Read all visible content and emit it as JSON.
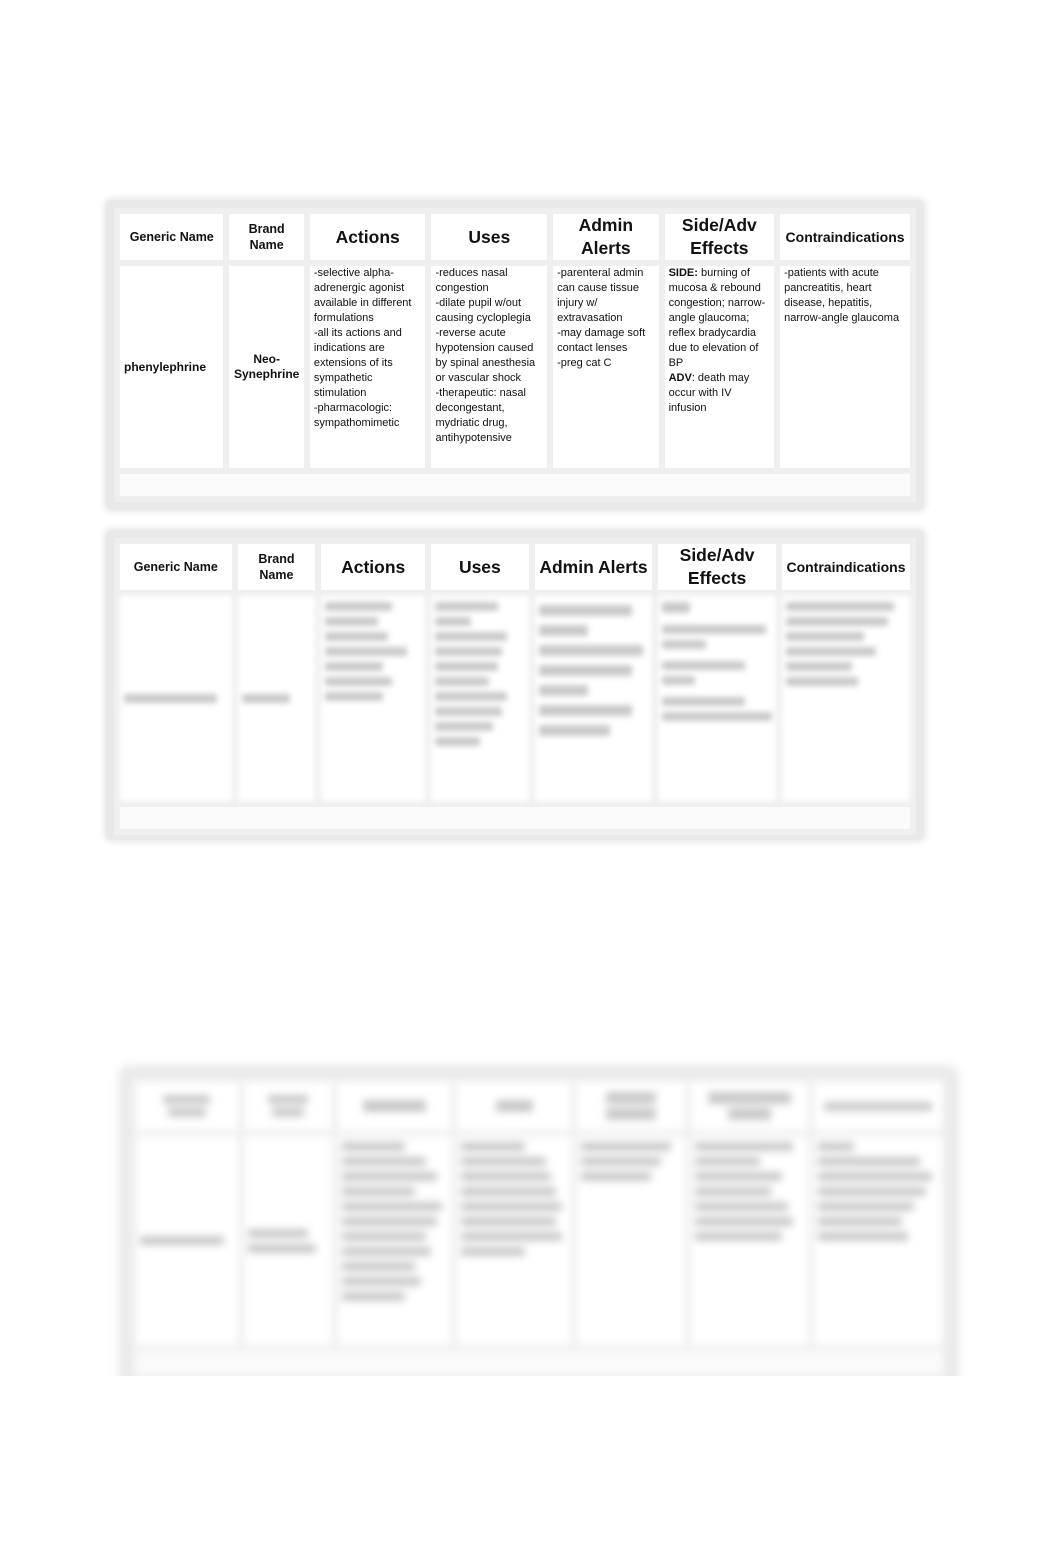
{
  "headers": {
    "generic": "Generic Name",
    "brand": "Brand Name",
    "actions": "Actions",
    "uses": "Uses",
    "admin": "Admin Alerts",
    "side": "Side/Adv Effects",
    "contra": "Contraindications"
  },
  "table1": {
    "generic_name": "phenylephrine",
    "brand_name": "Neo-Synephrine",
    "actions": [
      "-selective alpha-adrenergic agonist available in different formulations",
      "-all its actions and indications are extensions of its sympathetic stimulation",
      "-pharmacologic: sympathomimetic"
    ],
    "uses": [
      "-reduces nasal congestion",
      "-dilate pupil w/out causing cycloplegia",
      "-reverse acute hypotension caused by spinal anesthesia or vascular shock",
      "-therapeutic: nasal decongestant, mydriatic drug, antihypotensive"
    ],
    "admin_alerts": [
      "-parenteral admin can cause tissue injury w/ extravasation",
      "-may damage soft contact lenses",
      "-preg cat C"
    ],
    "side_effects": {
      "side_label": "SIDE:",
      "side_text": " burning of mucosa & rebound congestion; narrow-angle glaucoma; reflex bradycardia due to elevation of BP",
      "adv_label": "ADV",
      "adv_text": ": death may occur with IV infusion"
    },
    "contraindications": [
      "-patients with acute pancreatitis, heart disease, hepatitis, narrow-angle glaucoma"
    ]
  },
  "table2": {
    "blurred": true
  },
  "table3": {
    "blurred": true
  }
}
